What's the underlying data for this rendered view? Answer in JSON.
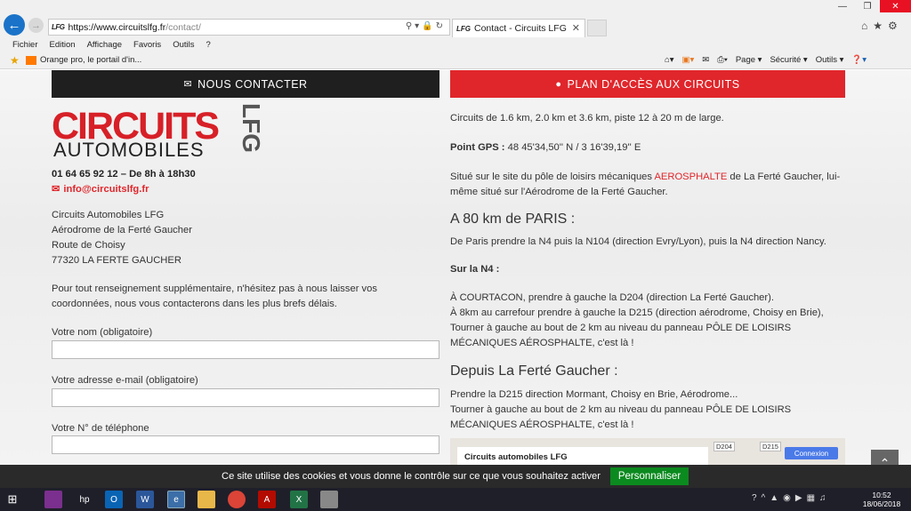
{
  "browser": {
    "url_host": "https://www.circuitslfg.fr",
    "url_path": "/contact/",
    "tab_title": "Contact - Circuits LFG",
    "favicon_text": "LFG",
    "menu": [
      "Fichier",
      "Edition",
      "Affichage",
      "Favoris",
      "Outils",
      "?"
    ],
    "favorites_item": "Orange pro, le portail d'in...",
    "commands": [
      "Page ▾",
      "Sécurité ▾",
      "Outils ▾"
    ]
  },
  "page": {
    "contact_button": "NOUS CONTACTER",
    "map_button": "PLAN D'ACCÈS AUX CIRCUITS",
    "logo": {
      "line1": "CIRCUITS",
      "line2": "AUTOMOBILES",
      "line3": "LFG"
    },
    "phone": "01 64 65 92 12 – De 8h à 18h30",
    "email": "info@circuitslfg.fr",
    "address": [
      "Circuits Automobiles LFG",
      "Aérodrome de la Ferté Gaucher",
      "Route de Choisy",
      "77320 LA FERTE GAUCHER"
    ],
    "intro": "Pour tout renseignement supplémentaire, n'hésitez pas à nous laisser vos coordonnées, nous vous contacterons dans les plus brefs délais.",
    "form": {
      "name_label": "Votre nom (obligatoire)",
      "email_label": "Votre adresse e-mail (obligatoire)",
      "phone_label": "Votre N° de téléphone"
    },
    "right": {
      "circuits": "Circuits de 1.6 km, 2.0 km et 3.6 km, piste 12 à 20 m de large.",
      "gps_label": "Point GPS :",
      "gps_value": " 48 45'34,50'' N / 3 16'39,19'' E",
      "site_before": "Situé sur le site du pôle de loisirs mécaniques ",
      "site_link": "AEROSPHALTE",
      "site_after": " de La Ferté Gaucher, lui-même situé sur l'Aérodrome de la Ferté Gaucher.",
      "h_paris": "A 80 km de PARIS :",
      "paris_text": "De Paris prendre la N4 puis la N104 (direction Evry/Lyon), puis la N4 direction Nancy.",
      "n4_label": "Sur la N4 :",
      "n4_line1": "À COURTACON, prendre à gauche la D204  (direction La Ferté Gaucher).",
      "n4_line2": "À 8km au carrefour prendre à gauche la D215 (direction aérodrome, Choisy en Brie),",
      "n4_line3": "Tourner à gauche au bout de 2 km au niveau du panneau PÔLE DE LOISIRS MÉCANIQUES AÉROSPHALTE, c'est là !",
      "h_ferte": "Depuis La Ferté Gaucher :",
      "ferte_line1": "Prendre la D215 direction Mormant, Choisy en Brie, Aérodrome...",
      "ferte_line2": "Tourner à gauche au bout de 2 km au niveau du panneau PÔLE DE LOISIRS MÉCANIQUES AÉROSPHALTE, c'est là !"
    },
    "map": {
      "card_title": "Circuits automobiles LFG",
      "road1": "D204",
      "road2": "D215",
      "connexion": "Connexion"
    }
  },
  "cookie": {
    "text": "Ce site utilise des cookies et vous donne le contrôle sur ce que vous souhaitez activer",
    "button": "Personnaliser"
  },
  "taskbar": {
    "time": "10:52",
    "date": "18/06/2018"
  }
}
